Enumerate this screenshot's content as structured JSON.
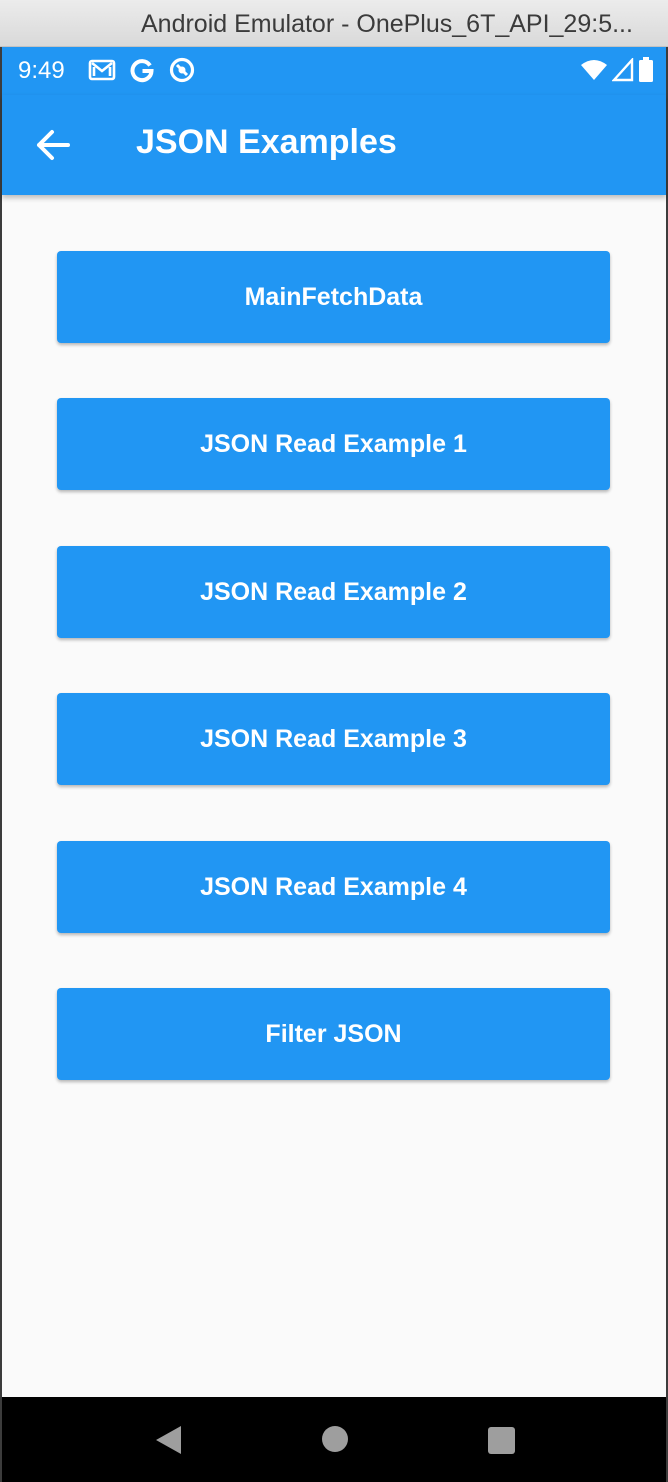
{
  "window": {
    "title": "Android Emulator - OnePlus_6T_API_29:5..."
  },
  "status_bar": {
    "time": "9:49",
    "left_icons": [
      "gmail-icon",
      "google-icon",
      "data-saver-icon"
    ],
    "right_icons": [
      "wifi-icon",
      "signal-icon",
      "battery-icon"
    ]
  },
  "app_bar": {
    "title": "JSON Examples",
    "back_icon": "arrow-back-icon"
  },
  "buttons": [
    {
      "label": "MainFetchData"
    },
    {
      "label": "JSON Read Example 1"
    },
    {
      "label": "JSON Read Example 2"
    },
    {
      "label": "JSON Read Example 3"
    },
    {
      "label": "JSON Read Example 4"
    },
    {
      "label": "Filter JSON"
    }
  ],
  "nav_bar": {
    "icons": [
      "nav-back-icon",
      "nav-home-icon",
      "nav-recents-icon"
    ]
  },
  "colors": {
    "primary": "#2196f3",
    "background": "#fafafa",
    "nav": "#000000"
  }
}
